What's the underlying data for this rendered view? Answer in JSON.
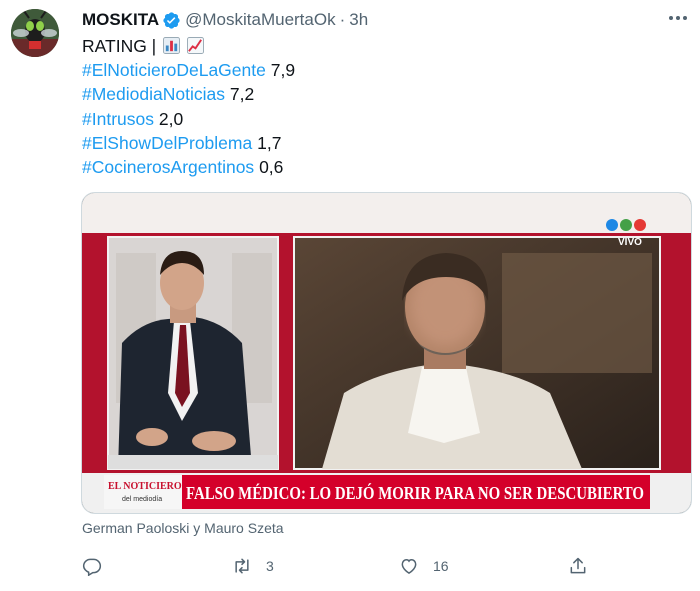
{
  "author": {
    "name": "MOSKITA",
    "handle": "@MoskitaMuertaOk",
    "separator": "·",
    "time": "3h"
  },
  "tweet": {
    "heading": "RATING |",
    "heading_emojis": [
      "bar-chart-emoji",
      "chart-increasing-emoji"
    ],
    "lines": [
      {
        "tag": "#ElNoticieroDeLaGente",
        "value": "7,9"
      },
      {
        "tag": "#MediodiaNoticias",
        "value": "7,2"
      },
      {
        "tag": "#Intrusos",
        "value": "2,0"
      },
      {
        "tag": "#ElShowDelProblema",
        "value": "1,7"
      },
      {
        "tag": "#CocinerosArgentinos",
        "value": "0,6"
      }
    ]
  },
  "media": {
    "live_label": "VIVO",
    "program_logo_line1": "EL NOTICIERO",
    "program_logo_line2": "del mediodía",
    "headline": "FALSO MÉDICO: LO DEJÓ MORIR PARA NO SER DESCUBIERTO",
    "colors": {
      "banner": "#d4002a",
      "frame": "#c8102e"
    }
  },
  "caption": "German Paoloski y Mauro Szeta",
  "actions": {
    "reply_count": "",
    "retweet_count": "3",
    "like_count": "16"
  },
  "colors": {
    "link": "#1d9bf0",
    "secondary": "#536471",
    "verified": "#1d9bf0"
  }
}
